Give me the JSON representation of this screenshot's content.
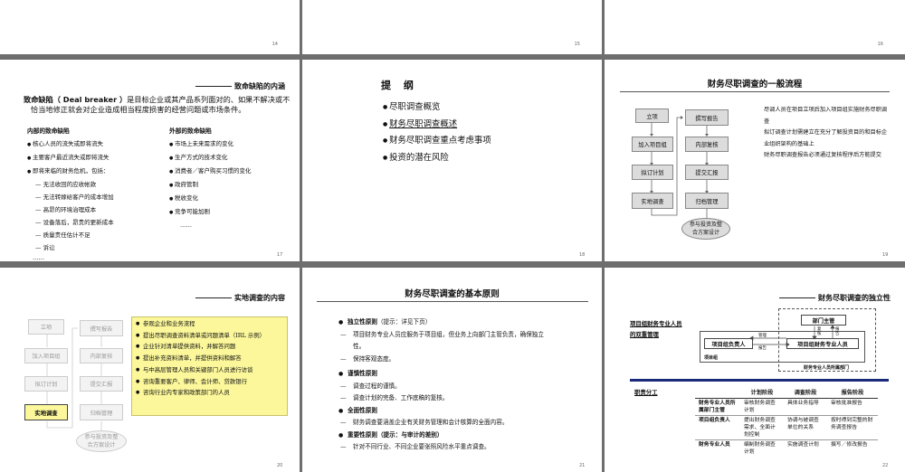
{
  "page_numbers": [
    "14",
    "15",
    "16",
    "17",
    "18",
    "19",
    "20",
    "21",
    "22"
  ],
  "slide17": {
    "header": "致命缺陷的内涵",
    "definition_term": "致命缺陷（ Deal breaker ）",
    "definition_text1": "是目标企业或其产品系列面对的、如果不解决或不",
    "definition_text2": "恰当地修正就会对企业造成相当程度损害的经营问题或市场条件。",
    "internal": {
      "title": "内部的致命缺陷",
      "bullets": [
        "核心人员的流失或即将流失",
        "主要客户最近流失或即将流失",
        "即将来临的财务危机，包括："
      ],
      "dashes": [
        "无法收回的应收帐款",
        "无法转嫁给客户的成本增加",
        "高昂的环境治理成本",
        "设备落后，昂贵的更新成本",
        "质量责任估计不足",
        "诉讼"
      ],
      "more": "……"
    },
    "external": {
      "title": "外部的致命缺陷",
      "bullets": [
        "市场上未来需求的变化",
        "生产方式的技术变化",
        "消费者／客户购买习惯的变化",
        "政府管制",
        "税收变化",
        "竞争可能加剧"
      ],
      "more": "……"
    }
  },
  "slide18": {
    "title": "提  纲",
    "items": [
      "尽职调查概览",
      "财务尽职调查概述",
      "财务尽职调查重点考虑事项",
      "投资的潜在风险"
    ]
  },
  "slide19": {
    "title": "财务尽职调查的一般流程",
    "left_boxes": [
      "立项",
      "加入项目组",
      "拟订计划",
      "实地调查"
    ],
    "right_boxes": [
      "撰写报告",
      "内部复核",
      "提交汇报",
      "归档管理"
    ],
    "oval": "参与投资及整合方案设计",
    "bullets": [
      "尽调人员在项目立项后加入项目组实施财务尽职调查",
      "拟订调查计划需建立在充分了解投资目的和目标企业组织架构的基础上",
      "财务尽职调查报告必须通过复核程序后方能提交"
    ]
  },
  "slide20": {
    "header": "实地调查的内容",
    "left_boxes": [
      "立项",
      "加入项目组",
      "拟订计划",
      "实地调查"
    ],
    "right_boxes": [
      "撰写报告",
      "内部复核",
      "提交汇报",
      "归档管理"
    ],
    "oval": "参与投资及整合方案设计",
    "items": [
      "参观企业和业务流程",
      "提出尽职调查资料清单或问题清单（IRL 示例）",
      "企业针对清单提供资料，并解答问题",
      "提出补充资料清单，并提供资料和解答",
      "与中高层管理人员和关键部门人员进行访谈",
      "咨询重要客户、律师、会计师、贷款银行",
      "咨询行业内专家和政策部门的人员"
    ]
  },
  "slide21": {
    "title": "财务尽职调查的基本原则",
    "principles": [
      {
        "name": "独立性原则",
        "note": "（提示：详见下页）",
        "details": [
          "项目财务专业人员应服务于项目组，但业务上向部门主管负责，确保独立性。",
          "保持客观态度。"
        ]
      },
      {
        "name": "谨慎性原则",
        "note": "",
        "details": [
          "调查过程的谨慎。",
          "调查计划的完备、工作底稿的复核。"
        ]
      },
      {
        "name": "全面性原则",
        "note": "",
        "details": [
          "财务调查要涵盖企业有关财务管理和会计核算的全面内容。"
        ]
      },
      {
        "name": "重要性原则",
        "note": "（提示：与审计的差别）",
        "details": [
          "针对不同行业、不同企业要张照风险水平重点调查。"
        ]
      }
    ]
  },
  "slide22": {
    "header": "财务尽职调查的独立性",
    "label_dual": "项目组财务专业人员的双重管理",
    "label_duty": "职责分工",
    "org": {
      "head": "部门主管",
      "leader": "项目组负责人",
      "staff": "项目组财务专业人员",
      "report": "报告",
      "report2": "报告",
      "manage": "管理",
      "review": "复核",
      "group": "项目组",
      "dept": "财务专业人员所属部门"
    },
    "table": {
      "headers": [
        "",
        "计划阶段",
        "调查阶段",
        "报告阶段"
      ],
      "rows": [
        [
          "财务专业人员所属部门主管",
          "审核财务调查计划",
          "具体业务指导",
          "审核批准报告"
        ],
        [
          "项目组负责人",
          "提出财务调查需求、全面计划控制",
          "协调与被调查单位的关系",
          "按时得到完整的财务调查报告"
        ],
        [
          "财务专业人员",
          "编制财务调查计划",
          "实施调查计划",
          "撰写／修改报告"
        ]
      ]
    }
  }
}
